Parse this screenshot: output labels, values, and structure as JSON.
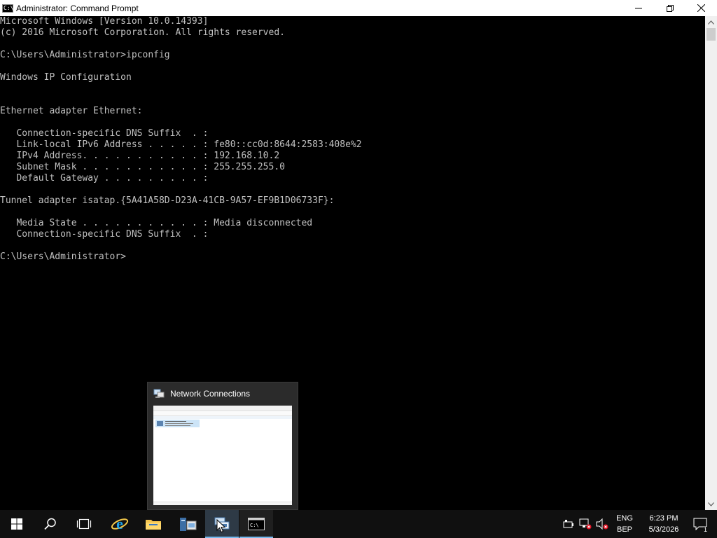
{
  "window": {
    "title": "Administrator: Command Prompt",
    "icon": "cmd-icon",
    "controls": [
      "minimize-icon",
      "restore-icon",
      "close-icon"
    ]
  },
  "console": {
    "lines": [
      "Microsoft Windows [Version 10.0.14393]",
      "(c) 2016 Microsoft Corporation. All rights reserved.",
      "",
      "C:\\Users\\Administrator>ipconfig",
      "",
      "Windows IP Configuration",
      "",
      "",
      "Ethernet adapter Ethernet:",
      "",
      "   Connection-specific DNS Suffix  . :",
      "   Link-local IPv6 Address . . . . . : fe80::cc0d:8644:2583:408e%2",
      "   IPv4 Address. . . . . . . . . . . : 192.168.10.2",
      "   Subnet Mask . . . . . . . . . . . : 255.255.255.0",
      "   Default Gateway . . . . . . . . . :",
      "",
      "Tunnel adapter isatap.{5A41A58D-D23A-41CB-9A57-EF9B1D06733F}:",
      "",
      "   Media State . . . . . . . . . . . : Media disconnected",
      "   Connection-specific DNS Suffix  . :",
      "",
      "C:\\Users\\Administrator>"
    ],
    "text_color": "#c0c0c0",
    "background": "#000000"
  },
  "preview": {
    "title": "Network Connections",
    "icon": "network-connections-icon"
  },
  "taskbar": {
    "items": [
      {
        "name": "start-button",
        "icon": "windows-logo-icon"
      },
      {
        "name": "search-button",
        "icon": "search-icon"
      },
      {
        "name": "task-view-button",
        "icon": "task-view-icon"
      },
      {
        "name": "internet-explorer-button",
        "icon": "internet-explorer-icon"
      },
      {
        "name": "file-explorer-button",
        "icon": "folder-icon"
      },
      {
        "name": "server-manager-button",
        "icon": "server-manager-icon"
      },
      {
        "name": "network-connections-button",
        "icon": "network-connections-icon"
      },
      {
        "name": "command-prompt-button",
        "icon": "cmd-icon"
      }
    ],
    "tray": {
      "language_top": "ENG",
      "language_bottom": "BEP",
      "time": "6:23 PM",
      "date": "5/3/2026",
      "notification_count": "1"
    }
  },
  "colors": {
    "taskbar": "#101010",
    "accent": "#76b9ed",
    "titlebar": "#ffffff"
  }
}
